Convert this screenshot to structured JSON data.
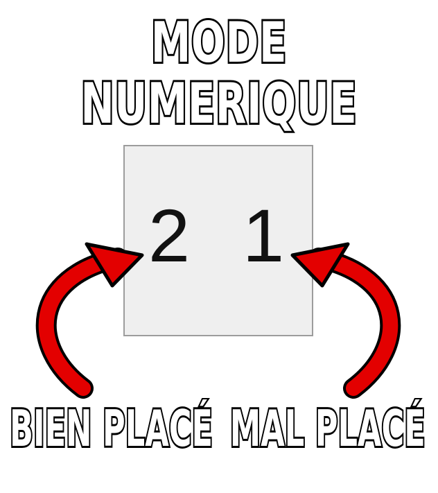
{
  "title": {
    "line1": "MODE",
    "line2": "NUMERIQUE"
  },
  "indicator": {
    "well_placed_count": "2",
    "misplaced_count": "1"
  },
  "labels": {
    "well_placed": "BIEN PLACÉ",
    "misplaced": "MAL PLACÉ"
  },
  "colors": {
    "arrow": "#e30000",
    "box_background": "#efefef",
    "box_border": "#9c9c9c"
  },
  "icons": {
    "left_arrow": "curved-arrow-icon",
    "right_arrow": "curved-arrow-icon"
  }
}
